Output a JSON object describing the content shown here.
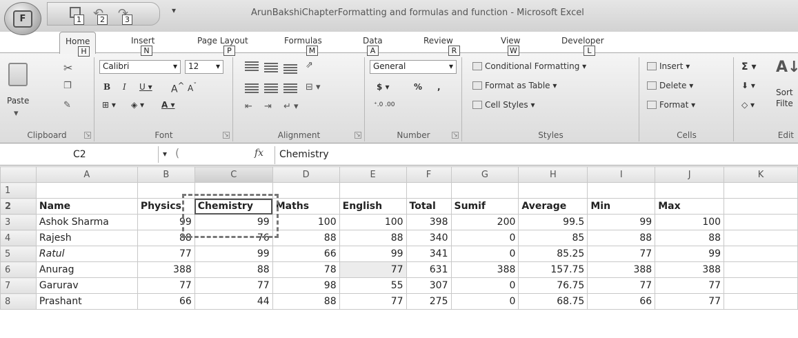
{
  "window": {
    "title": "ArunBakshiChapterFormatting and formulas and function - Microsoft Excel",
    "office_button_keytip": "F",
    "qat_keytips": [
      "1",
      "2",
      "3"
    ]
  },
  "tabs": [
    {
      "label": "Home",
      "keytip": "H"
    },
    {
      "label": "Insert",
      "keytip": "N"
    },
    {
      "label": "Page Layout",
      "keytip": "P"
    },
    {
      "label": "Formulas",
      "keytip": "M"
    },
    {
      "label": "Data",
      "keytip": "A"
    },
    {
      "label": "Review",
      "keytip": "R"
    },
    {
      "label": "View",
      "keytip": "W"
    },
    {
      "label": "Developer",
      "keytip": "L"
    }
  ],
  "ribbon": {
    "clipboard": {
      "label": "Clipboard",
      "paste": "Paste"
    },
    "font": {
      "label": "Font",
      "name": "Calibri",
      "size": "12"
    },
    "alignment": {
      "label": "Alignment"
    },
    "number": {
      "label": "Number",
      "format": "General",
      "currency": "$",
      "percent": "%",
      "comma": ","
    },
    "styles": {
      "label": "Styles",
      "conditional": "Conditional Formatting",
      "format_table": "Format as Table",
      "cell_styles": "Cell Styles"
    },
    "cells": {
      "label": "Cells",
      "insert": "Insert",
      "delete": "Delete",
      "format": "Format"
    },
    "editing": {
      "label": "Edit",
      "sort": "Sort",
      "filter": "Filte"
    }
  },
  "formula_bar": {
    "name_box": "C2",
    "fx": "fx",
    "content": "Chemistry"
  },
  "columns": [
    "A",
    "B",
    "C",
    "D",
    "E",
    "F",
    "G",
    "H",
    "I",
    "J",
    "K"
  ],
  "rows": [
    {
      "n": "1",
      "cells": [
        "",
        "",
        "",
        "",
        "",
        "",
        "",
        "",
        "",
        "",
        ""
      ]
    },
    {
      "n": "2",
      "cells": [
        "Name",
        "Physics",
        "Chemistry",
        "Maths",
        "English",
        "Total",
        "Sumif",
        "Average",
        "Min",
        "Max",
        ""
      ]
    },
    {
      "n": "3",
      "cells": [
        "Ashok Sharma",
        "99",
        "99",
        "100",
        "100",
        "398",
        "200",
        "99.5",
        "99",
        "100",
        ""
      ]
    },
    {
      "n": "4",
      "cells": [
        "Rajesh",
        "88",
        "76",
        "88",
        "88",
        "340",
        "0",
        "85",
        "88",
        "88",
        ""
      ]
    },
    {
      "n": "5",
      "cells": [
        "Ratul",
        "77",
        "99",
        "66",
        "99",
        "341",
        "0",
        "85.25",
        "77",
        "99",
        ""
      ]
    },
    {
      "n": "6",
      "cells": [
        "Anurag",
        "388",
        "88",
        "78",
        "77",
        "631",
        "388",
        "157.75",
        "388",
        "388",
        ""
      ]
    },
    {
      "n": "7",
      "cells": [
        "Garurav",
        "77",
        "77",
        "98",
        "55",
        "307",
        "0",
        "76.75",
        "77",
        "77",
        ""
      ]
    },
    {
      "n": "8",
      "cells": [
        "Prashant",
        "66",
        "44",
        "88",
        "77",
        "275",
        "0",
        "68.75",
        "66",
        "77",
        ""
      ]
    }
  ]
}
